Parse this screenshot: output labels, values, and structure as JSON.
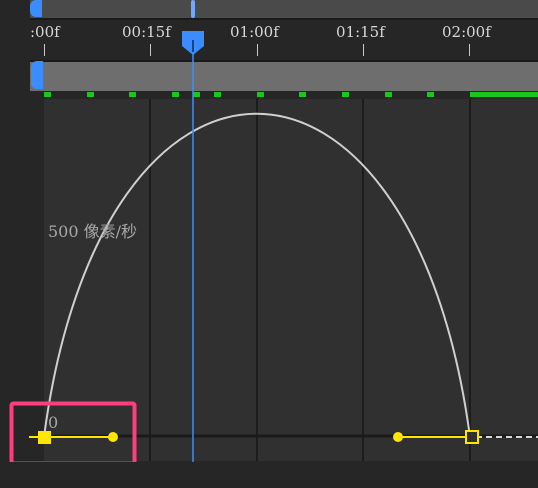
{
  "ruler": {
    "ticks": [
      ":00f",
      "00:15f",
      "01:00f",
      "01:15f",
      "02:00f"
    ]
  },
  "graph": {
    "speed_label": "500 像素/秒",
    "zero_label": "0"
  },
  "colors": {
    "background": "#262626",
    "graph_bg": "#303030",
    "grid": "#1c1c1c",
    "curve": "#d0d0d0",
    "keyframe": "#ffe600",
    "playhead": "#3b8dff",
    "marker_green": "#19c71e",
    "highlight": "#ff3d7f"
  }
}
